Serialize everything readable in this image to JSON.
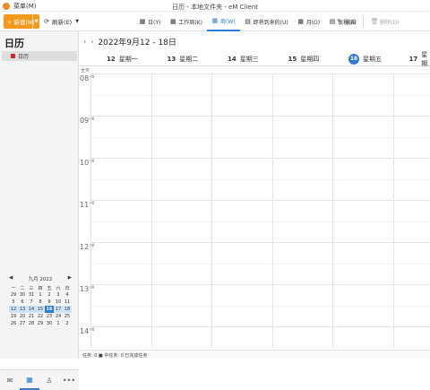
{
  "titlebar": {
    "menu_label": "菜单(M)",
    "window_title": "日历 - 本地文件夹 - eM Client"
  },
  "toolbar": {
    "new_label": "+ 新建(N)",
    "refresh_label": "刷新(E)",
    "views": [
      {
        "label": "日(Y)",
        "icon": "day-icon"
      },
      {
        "label": "工作周(K)",
        "icon": "workweek-icon"
      },
      {
        "label": "周(W)",
        "icon": "week-icon",
        "active": true
      },
      {
        "label": "即将到来的(U)",
        "icon": "upcoming-icon"
      },
      {
        "label": "月(O)",
        "icon": "month-icon"
      },
      {
        "label": "议程(A)",
        "icon": "agenda-icon"
      }
    ],
    "actions": [
      {
        "label": "编辑",
        "icon": "pencil-icon"
      },
      {
        "label": "删除(D)",
        "icon": "trash-icon"
      }
    ]
  },
  "sidebar": {
    "title": "日历",
    "calendar_item": "日历",
    "mini_calendar": {
      "month_label": "九月 2022",
      "weekdays": [
        "一",
        "二",
        "三",
        "四",
        "五",
        "六",
        "日"
      ],
      "weeks": [
        [
          "29",
          "30",
          "31",
          "1",
          "2",
          "3",
          "4"
        ],
        [
          "5",
          "6",
          "7",
          "8",
          "9",
          "10",
          "11"
        ],
        [
          "12",
          "13",
          "14",
          "15",
          "16",
          "17",
          "18"
        ],
        [
          "19",
          "20",
          "21",
          "22",
          "23",
          "24",
          "25"
        ],
        [
          "26",
          "27",
          "28",
          "29",
          "30",
          "1",
          "2"
        ]
      ],
      "selected_week": 2,
      "today": "16"
    }
  },
  "calendar": {
    "range": "2022年9月12 - 18日",
    "days": [
      {
        "num": "12",
        "name": "星期一"
      },
      {
        "num": "13",
        "name": "星期二"
      },
      {
        "num": "14",
        "name": "星期三"
      },
      {
        "num": "15",
        "name": "星期四"
      },
      {
        "num": "16",
        "name": "星期五",
        "today": true
      },
      {
        "num": "17",
        "name": "星期"
      }
    ],
    "allday_label": "全天",
    "hours": [
      "08",
      "09",
      "10",
      "11",
      "12",
      "13",
      "14"
    ],
    "minute_label": "00"
  },
  "statusbar": {
    "text": "任务: 0 ■ 中任务: 0 已完成任务"
  },
  "colors": {
    "accent": "#2f7bd6",
    "new_button": "#f39a1e",
    "calendar_red": "#d91f26"
  }
}
